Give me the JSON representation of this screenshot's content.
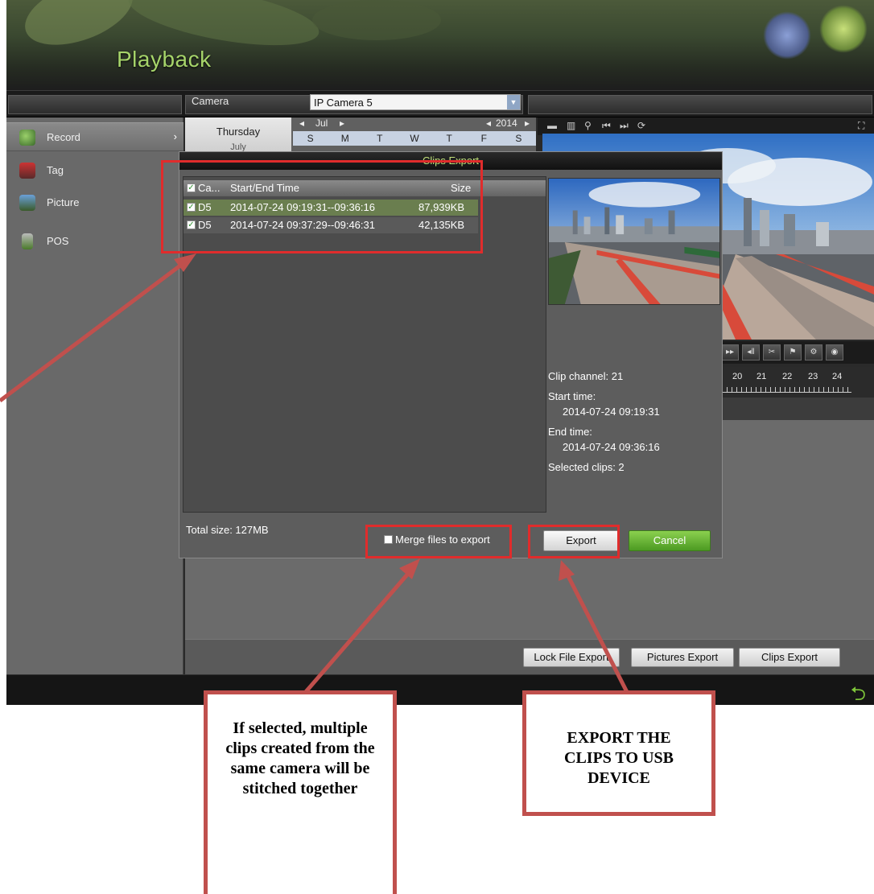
{
  "app": {
    "title": "Playback"
  },
  "camera": {
    "label": "Camera",
    "value": "IP Camera 5"
  },
  "sidebar": {
    "items": [
      {
        "label": "Record",
        "icon": "record-icon",
        "active": true
      },
      {
        "label": "Tag",
        "icon": "tag-icon"
      },
      {
        "label": "Picture",
        "icon": "picture-icon"
      },
      {
        "label": "POS",
        "icon": "pos-icon"
      }
    ],
    "chevron": "›"
  },
  "calendar": {
    "day_name": "Thursday",
    "day_sub": "July",
    "month": "Jul",
    "year": "2014",
    "weekdays": [
      "S",
      "M",
      "T",
      "W",
      "T",
      "F",
      "S"
    ]
  },
  "timeline": {
    "ticks": [
      "20",
      "21",
      "22",
      "23",
      "24"
    ]
  },
  "bottom_buttons": {
    "lock_file_export": "Lock File Export",
    "pictures_export": "Pictures Export",
    "clips_export": "Clips Export"
  },
  "dialog": {
    "title": "Clips Export",
    "columns": {
      "camera": "Ca...",
      "time": "Start/End Time",
      "size": "Size"
    },
    "rows": [
      {
        "camera": "D5",
        "time": "2014-07-24 09:19:31--09:36:16",
        "size": "87,939KB",
        "checked": true
      },
      {
        "camera": "D5",
        "time": "2014-07-24 09:37:29--09:46:31",
        "size": "42,135KB",
        "checked": true
      }
    ],
    "clip_channel": "Clip channel: 21",
    "start_label": "Start time:",
    "start_value": "2014-07-24 09:19:31",
    "end_label": "End time:",
    "end_value": "2014-07-24 09:36:16",
    "selected_clips": "Selected clips: 2",
    "total_size": "Total size: 127MB",
    "merge_label": "Merge files to export",
    "export_label": "Export",
    "cancel_label": "Cancel"
  },
  "callouts": {
    "merge": "If selected, multiple clips created from the same camera will be stitched together",
    "export": "EXPORT THE CLIPS TO USB DEVICE"
  },
  "colors": {
    "highlight": "#e02c2c",
    "arrow": "#c0504d",
    "accent_green": "#a6d46a",
    "cancel_green": "#5aab2c"
  }
}
